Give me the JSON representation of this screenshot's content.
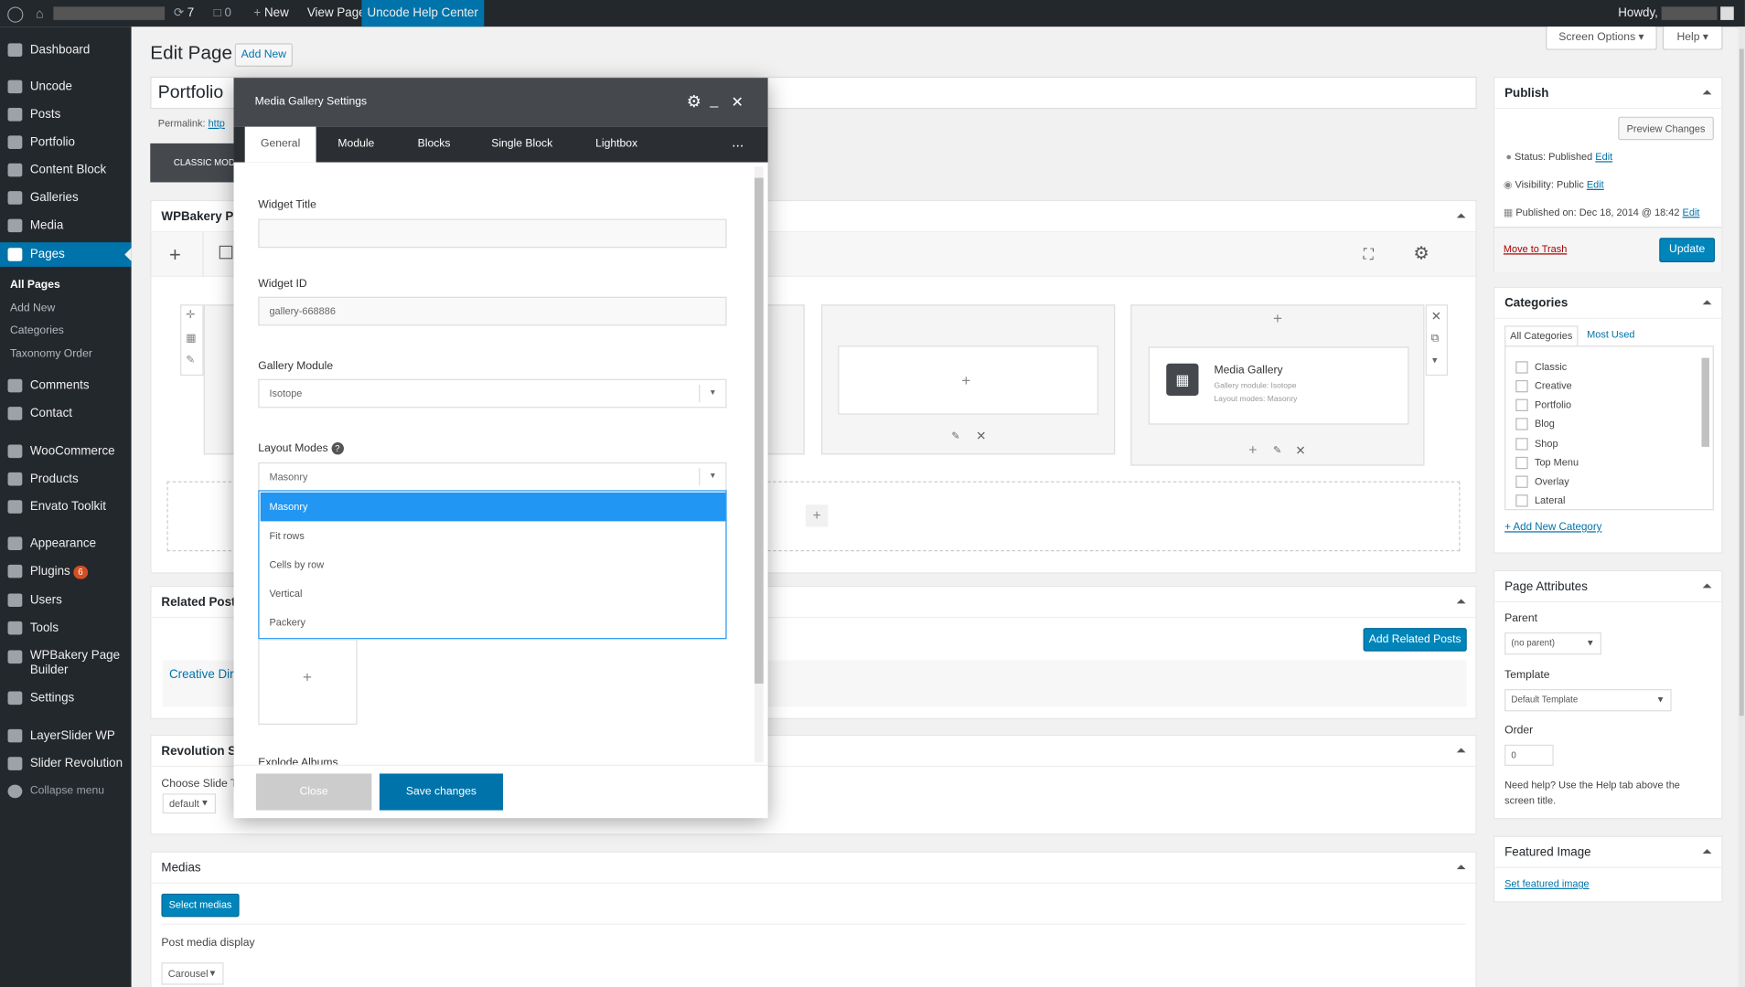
{
  "adminbar": {
    "updates": "7",
    "comments": "0",
    "new": "New",
    "view_page": "View Page",
    "help_center": "Uncode Help Center",
    "howdy": "Howdy,"
  },
  "sidebar": {
    "items": [
      {
        "label": "Dashboard",
        "icon": "dashboard-icon"
      },
      {
        "label": "Uncode",
        "icon": "uncode-icon"
      },
      {
        "label": "Posts",
        "icon": "pin-icon"
      },
      {
        "label": "Portfolio",
        "icon": "grid-icon"
      },
      {
        "label": "Content Block",
        "icon": "list-icon"
      },
      {
        "label": "Galleries",
        "icon": "gallery-icon"
      },
      {
        "label": "Media",
        "icon": "media-icon"
      },
      {
        "label": "Pages",
        "icon": "page-icon"
      },
      {
        "label": "Comments",
        "icon": "comment-icon"
      },
      {
        "label": "Contact",
        "icon": "mail-icon"
      },
      {
        "label": "WooCommerce",
        "icon": "woo-icon"
      },
      {
        "label": "Products",
        "icon": "box-icon"
      },
      {
        "label": "Envato Toolkit",
        "icon": "leaf-icon"
      },
      {
        "label": "Appearance",
        "icon": "brush-icon"
      },
      {
        "label": "Plugins",
        "icon": "plug-icon"
      },
      {
        "label": "Users",
        "icon": "user-icon"
      },
      {
        "label": "Tools",
        "icon": "wrench-icon"
      },
      {
        "label": "WPBakery Page Builder",
        "icon": "builder-icon"
      },
      {
        "label": "Settings",
        "icon": "settings-icon"
      },
      {
        "label": "LayerSlider WP",
        "icon": "layers-icon"
      },
      {
        "label": "Slider Revolution",
        "icon": "refresh-icon"
      },
      {
        "label": "Collapse menu",
        "icon": "collapse-icon"
      }
    ],
    "plugins_badge": "6",
    "pages_sub": [
      "All Pages",
      "Add New",
      "Categories",
      "Taxonomy Order"
    ]
  },
  "header": {
    "title": "Edit Page",
    "add_new": "Add New",
    "screen_options": "Screen Options",
    "help": "Help"
  },
  "editor": {
    "post_title": "Portfolio",
    "permalink_label": "Permalink:",
    "permalink_link": "http",
    "classic_mode": "CLASSIC MODE",
    "wpbakery_title": "WPBakery Page",
    "related_posts": "Related Posts",
    "creative_dir": "Creative Dire",
    "add_related": "Add Related Posts",
    "revolution": "Revolution Sli",
    "choose_slide": "Choose Slide Te",
    "slide_default": "default",
    "medias": "Medias",
    "select_medias": "Select medias",
    "post_media_display": "Post media display",
    "carousel": "Carousel"
  },
  "element": {
    "name": "Media Gallery",
    "module_line": "Gallery module: Isotope",
    "layout_line": "Layout modes: Masonry"
  },
  "modal": {
    "title": "Media Gallery Settings",
    "tabs": [
      "General",
      "Module",
      "Blocks",
      "Single Block",
      "Lightbox"
    ],
    "more": "...",
    "widget_title_label": "Widget Title",
    "widget_title_value": "",
    "widget_id_label": "Widget ID",
    "widget_id_value": "gallery-668886",
    "gallery_module_label": "Gallery Module",
    "gallery_module_value": "Isotope",
    "layout_modes_label": "Layout Modes",
    "layout_modes_value": "Masonry",
    "layout_options": [
      "Masonry",
      "Fit rows",
      "Cells by row",
      "Vertical",
      "Packery"
    ],
    "explode_label": "Explode Albums",
    "close": "Close",
    "save": "Save changes"
  },
  "publish": {
    "title": "Publish",
    "preview": "Preview Changes",
    "status": "Status: Published",
    "visibility": "Visibility: Public",
    "published_on": "Published on: Dec 18, 2014 @ 18:42",
    "edit": "Edit",
    "trash": "Move to Trash",
    "update": "Update"
  },
  "categories": {
    "title": "Categories",
    "tab_all": "All Categories",
    "tab_used": "Most Used",
    "items": [
      "Classic",
      "Creative",
      "Portfolio",
      "Blog",
      "Shop",
      "Top Menu",
      "Overlay",
      "Lateral"
    ],
    "add_new": "+ Add New Category"
  },
  "attributes": {
    "title": "Page Attributes",
    "parent_label": "Parent",
    "parent_value": "(no parent)",
    "template_label": "Template",
    "template_value": "Default Template",
    "order_label": "Order",
    "order_value": "0",
    "help": "Need help? Use the Help tab above the screen title."
  },
  "featured": {
    "title": "Featured Image",
    "link": "Set featured image"
  }
}
